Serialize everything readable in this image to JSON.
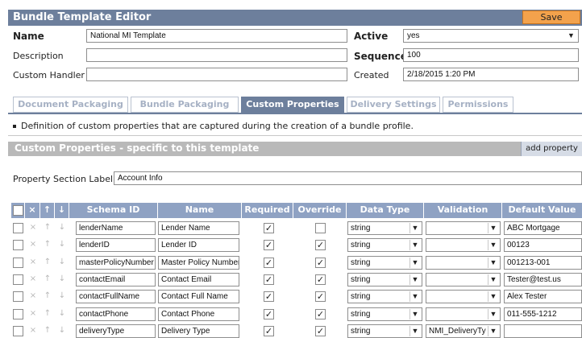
{
  "window": {
    "title": "Bundle Template Editor",
    "save_label": "Save"
  },
  "form": {
    "name_label": "Name",
    "name_value": "National MI Template",
    "description_label": "Description",
    "description_value": "",
    "custom_handler_label": "Custom Handler",
    "custom_handler_value": "",
    "active_label": "Active",
    "active_value": "yes",
    "sequence_label": "Sequence",
    "sequence_value": "100",
    "created_label": "Created",
    "created_value": "2/18/2015 1:20 PM"
  },
  "tabs": [
    {
      "label": "Document Packaging",
      "active": false
    },
    {
      "label": "Bundle Packaging",
      "active": false
    },
    {
      "label": "Custom Properties",
      "active": true
    },
    {
      "label": "Delivery Settings",
      "active": false
    },
    {
      "label": "Permissions",
      "active": false
    }
  ],
  "description_text": "Definition of custom properties that are captured during the creation of a bundle profile.",
  "section": {
    "title": "Custom Properties - specific to this template",
    "add_label": "add property",
    "property_section_label": "Property Section Label",
    "property_section_value": "Account Info"
  },
  "table": {
    "headers": {
      "delete": "×",
      "up": "↑",
      "down": "↓",
      "schema_id": "Schema ID",
      "name": "Name",
      "required": "Required",
      "override": "Override",
      "data_type": "Data Type",
      "validation": "Validation",
      "default_value": "Default Value"
    },
    "rows": [
      {
        "schema_id": "lenderName",
        "name": "Lender Name",
        "required": true,
        "override": false,
        "data_type": "string",
        "validation": "",
        "default_value": "ABC Mortgage"
      },
      {
        "schema_id": "lenderID",
        "name": "Lender ID",
        "required": true,
        "override": true,
        "data_type": "string",
        "validation": "",
        "default_value": "00123"
      },
      {
        "schema_id": "masterPolicyNumber",
        "name": "Master Policy Number",
        "required": true,
        "override": true,
        "data_type": "string",
        "validation": "",
        "default_value": "001213-001"
      },
      {
        "schema_id": "contactEmail",
        "name": "Contact Email",
        "required": true,
        "override": true,
        "data_type": "string",
        "validation": "",
        "default_value": "Tester@test.us"
      },
      {
        "schema_id": "contactFullName",
        "name": "Contact Full Name",
        "required": true,
        "override": true,
        "data_type": "string",
        "validation": "",
        "default_value": "Alex Tester"
      },
      {
        "schema_id": "contactPhone",
        "name": "Contact Phone",
        "required": true,
        "override": true,
        "data_type": "string",
        "validation": "",
        "default_value": "011-555-1212"
      },
      {
        "schema_id": "deliveryType",
        "name": "Delivery Type",
        "required": true,
        "override": true,
        "data_type": "string",
        "validation": "NMI_DeliveryTy",
        "default_value": ""
      }
    ]
  },
  "icons": {
    "delete": "close-icon",
    "up": "arrow-up-icon",
    "down": "arrow-down-icon",
    "dropdown": "chevron-down-icon",
    "check": "checkmark-icon"
  }
}
